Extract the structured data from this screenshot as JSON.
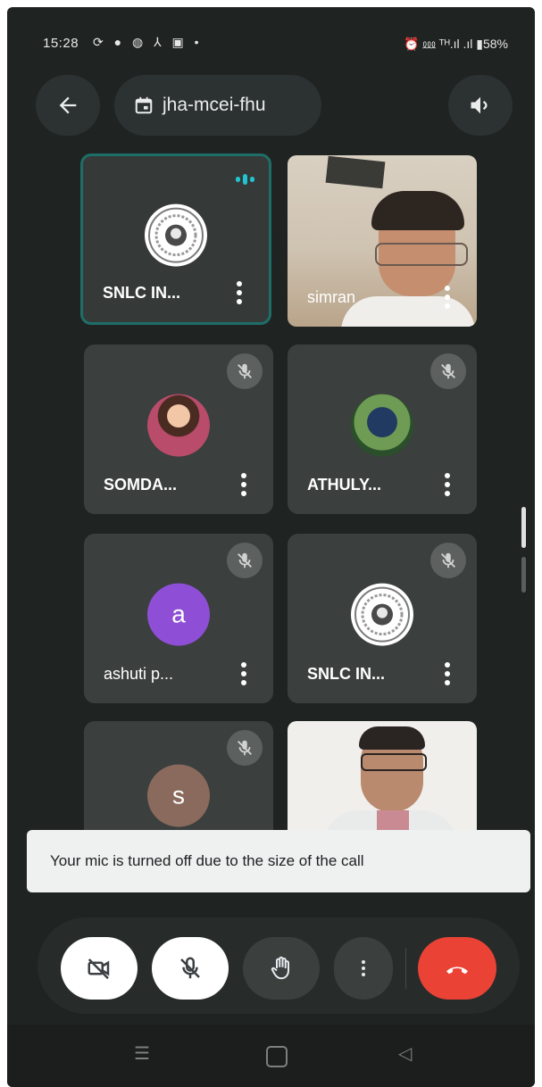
{
  "status_bar": {
    "time": "15:28",
    "left_icons": "⟳ ● ◍ ⅄ ▣ •",
    "right_text": "⏰ ⅏ ᵀᴴ.ıl .ıl ▮58%",
    "battery": "58%"
  },
  "header": {
    "meeting_code": "jha-mcei-fhu",
    "back_icon": "back-arrow-icon",
    "speaker_icon": "speaker-icon"
  },
  "participants": [
    {
      "name": "SNLC IN...",
      "kind": "logo",
      "speaking": true
    },
    {
      "name": "simran",
      "kind": "video"
    },
    {
      "name": "SOMDA...",
      "kind": "photo",
      "muted": true
    },
    {
      "name": "ATHULY...",
      "kind": "photo",
      "muted": true
    },
    {
      "name": "ashuti p...",
      "kind": "initial",
      "initial": "a",
      "color": "#8e4fd6",
      "muted": true
    },
    {
      "name": "SNLC IN...",
      "kind": "logo",
      "muted": true
    },
    {
      "name": "",
      "kind": "initial",
      "initial": "s",
      "color": "#8a6a5c",
      "muted": true
    },
    {
      "name": "",
      "kind": "video"
    }
  ],
  "toast": {
    "message": "Your mic is turned off due to the size of the call"
  },
  "controls": {
    "camera_off": "camera-off-icon",
    "mic_off": "mic-off-icon",
    "raise_hand": "hand-icon",
    "more": "more-vert-icon",
    "end_call": "end-call-icon",
    "end_call_color": "#ea4335"
  },
  "colors": {
    "background": "#1f2322",
    "tile": "#3b3f3e",
    "accent": "#22c4cf"
  }
}
